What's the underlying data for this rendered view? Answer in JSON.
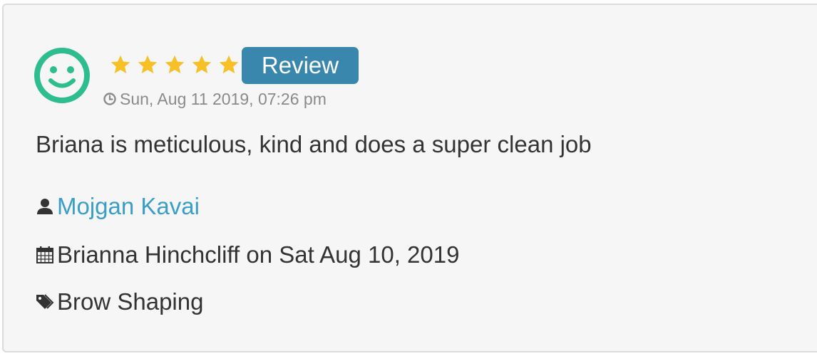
{
  "review": {
    "rating": 5,
    "rating_max": 5,
    "badge_label": "Review",
    "date": "Sun, Aug 11 2019, 07:26 pm",
    "text": "Briana is meticulous, kind and does a super clean job",
    "reviewer_name": "Mojgan Kavai",
    "appointment": "Brianna Hinchcliff on Sat Aug 10, 2019",
    "service": "Brow Shaping"
  },
  "icons": {
    "avatar": "smiley-face-icon",
    "star": "star-icon",
    "date": "clock-icon",
    "reviewer": "user-icon",
    "appointment": "calendar-icon",
    "service": "tag-icon"
  },
  "colors": {
    "avatar": "#2ebd8f",
    "star": "#f6c026",
    "badge_background": "#3a87ad",
    "link": "#3a9ec7",
    "card_background": "#f6f6f6"
  }
}
